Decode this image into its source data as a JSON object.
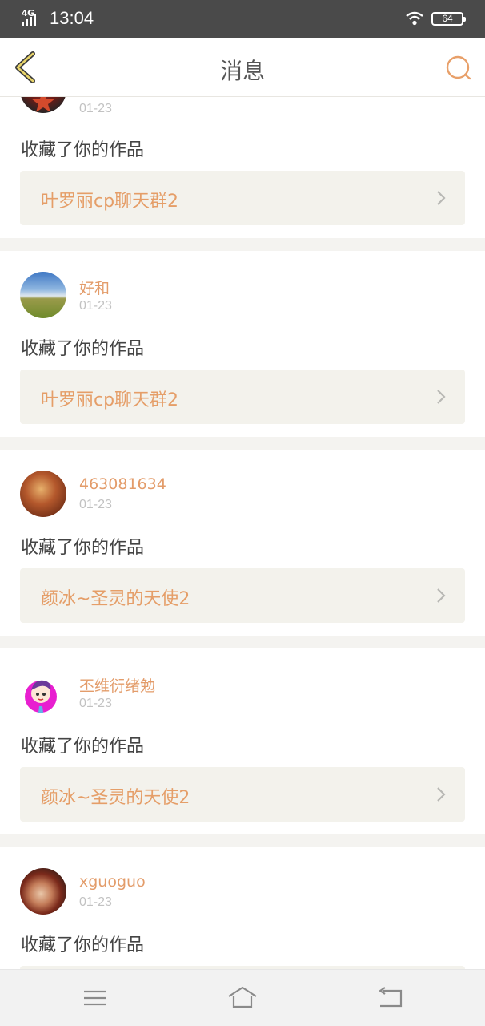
{
  "status_bar": {
    "network": "4G",
    "time": "13:04",
    "battery": "64"
  },
  "header": {
    "title": "消息"
  },
  "messages": [
    {
      "username": "",
      "date": "01-23",
      "action": "收藏了你的作品",
      "work_title": "叶罗丽cp聊天群2"
    },
    {
      "username": "好和",
      "date": "01-23",
      "action": "收藏了你的作品",
      "work_title": "叶罗丽cp聊天群2"
    },
    {
      "username": "463081634",
      "date": "01-23",
      "action": "收藏了你的作品",
      "work_title": "颜冰~圣灵的天使2"
    },
    {
      "username": "丕维衍绪勉",
      "date": "01-23",
      "action": "收藏了你的作品",
      "work_title": "颜冰~圣灵的天使2"
    },
    {
      "username": "xguoguo",
      "date": "01-23",
      "action": "收藏了你的作品",
      "work_title": ""
    }
  ],
  "colors": {
    "accent": "#e59e68",
    "status_bar": "#4a4a4a",
    "background": "#f4f3f0"
  },
  "icons": {
    "back": "chevron-left-icon",
    "search": "search-icon",
    "menu": "menu-icon",
    "home": "home-icon",
    "return": "return-icon"
  }
}
